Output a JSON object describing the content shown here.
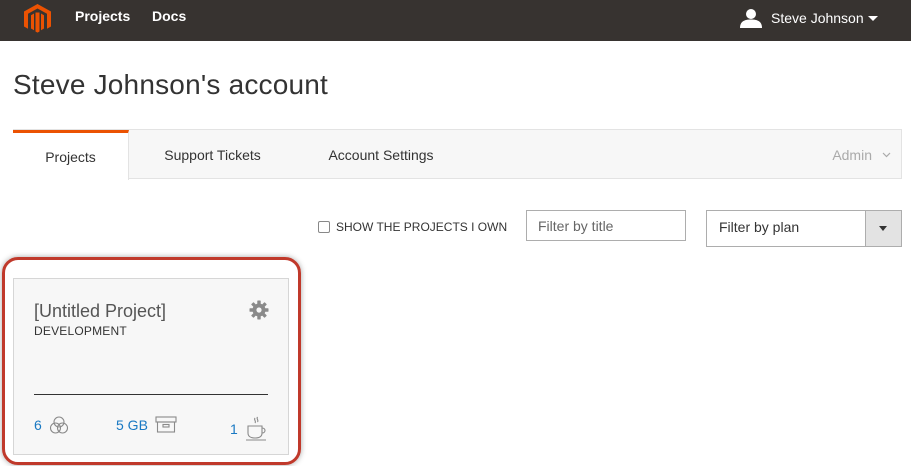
{
  "nav": {
    "logo_icon": "magento-logo-icon",
    "projects_label": "Projects",
    "docs_label": "Docs",
    "user_name": "Steve Johnson",
    "accent": "#eb5202"
  },
  "page": {
    "title": "Steve Johnson's account"
  },
  "tabs": {
    "items": [
      {
        "label": "Projects",
        "active": true
      },
      {
        "label": "Support Tickets",
        "active": false
      },
      {
        "label": "Account Settings",
        "active": false
      }
    ],
    "admin_label": "Admin"
  },
  "filters": {
    "own_projects_label": "SHOW THE PROJECTS I OWN",
    "own_projects_checked": false,
    "title_placeholder": "Filter by title",
    "plan_selected": "Filter by plan"
  },
  "project_card": {
    "title": "[Untitled Project]",
    "plan": "DEVELOPMENT",
    "environments": "6",
    "environments_icon": "environments-icon",
    "storage": "5 GB",
    "storage_icon": "storage-box-icon",
    "users": "1",
    "users_icon": "coffee-cup-icon",
    "highlight_color": "#c0392b"
  }
}
